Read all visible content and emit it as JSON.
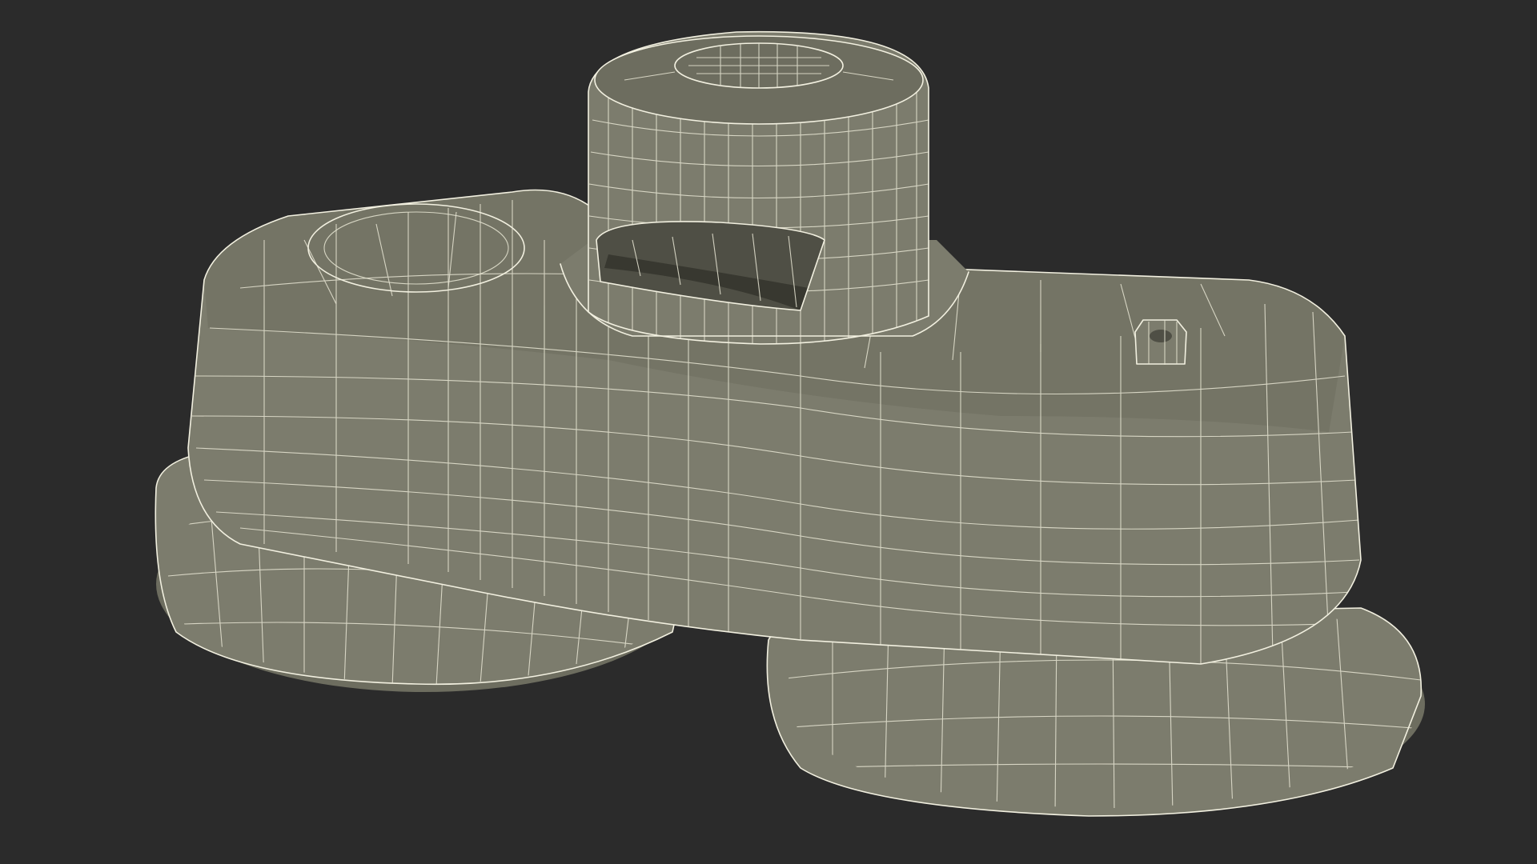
{
  "background_color": "#2b2b2b",
  "model_fill_color": "#7c7c6d",
  "wireframe_color": "#f2f0e0",
  "subject": "wireframe-3d-model"
}
